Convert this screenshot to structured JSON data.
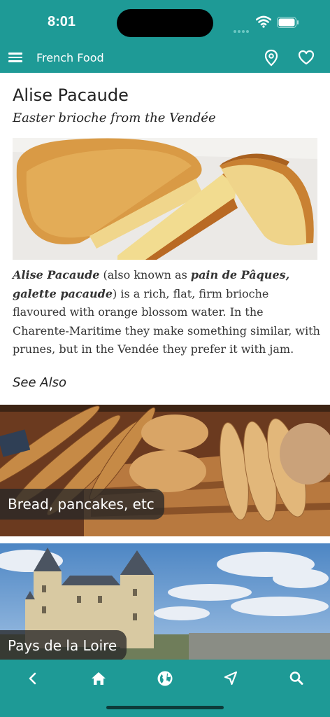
{
  "status": {
    "time": "8:01"
  },
  "header": {
    "title": "French Food"
  },
  "article": {
    "title": "Alise Pacaude",
    "subtitle": "Easter brioche from the Vendée",
    "body_bold_1": "Alise Pacaude",
    "body_text_1": " (also known as ",
    "body_bold_2": "pain de Pâques, galette pacaude",
    "body_text_2": ") is a rich, flat, firm brioche flavoured with orange blossom water. In the Charente-Maritime they make something similar, with prunes, but in the Vendée they prefer it with jam.",
    "see_also": "See Also"
  },
  "cards": [
    {
      "label": "Bread, pancakes, etc"
    },
    {
      "label": "Pays de la Loire"
    }
  ],
  "bottom_nav": [
    {
      "icon": "back-icon"
    },
    {
      "icon": "home-icon"
    },
    {
      "icon": "globe-icon"
    },
    {
      "icon": "navigate-icon"
    },
    {
      "icon": "search-icon"
    }
  ],
  "colors": {
    "accent": "#1e9a96",
    "text": "#333333"
  }
}
